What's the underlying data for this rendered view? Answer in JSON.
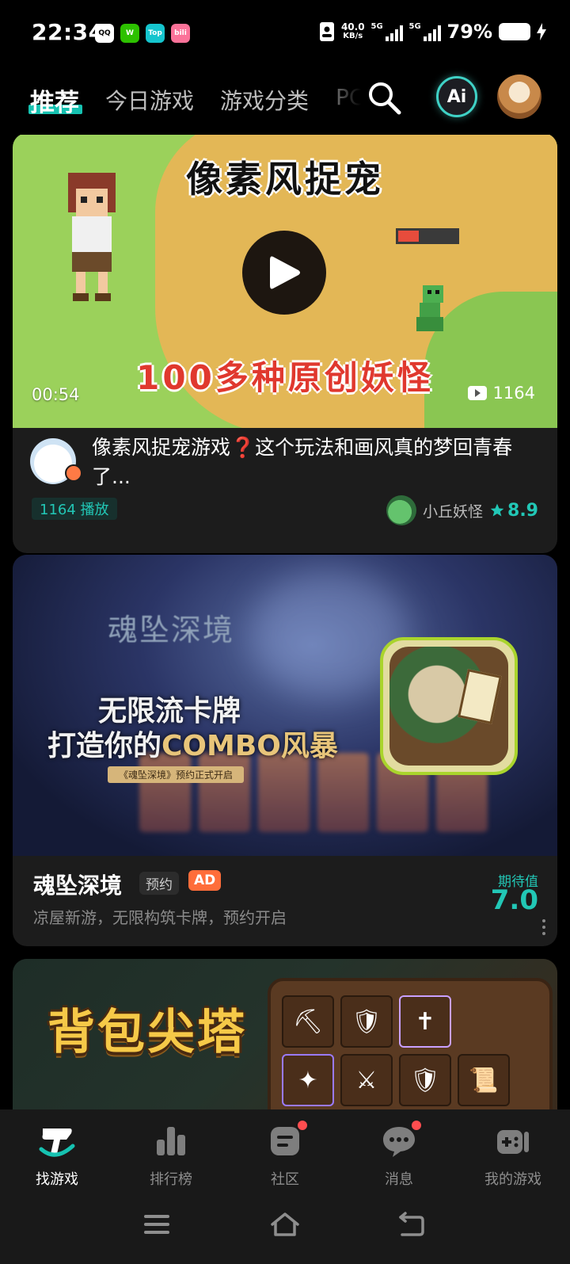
{
  "status_bar": {
    "time": "22:34",
    "notification_apps": [
      {
        "name": "qq-icon",
        "label": "QQ",
        "color": "#ffffff"
      },
      {
        "name": "wechat-icon",
        "label": "W",
        "color": "#2dc100"
      },
      {
        "name": "taptap-icon",
        "label": "Top",
        "color": "#15c5ce"
      },
      {
        "name": "bilibili-icon",
        "label": "bili",
        "color": "#fb7299"
      }
    ],
    "net_speed_value": "40.0",
    "net_speed_unit": "KB/s",
    "signal_1_label": "5G",
    "signal_2_label": "5G",
    "battery_text": "79%"
  },
  "header": {
    "tabs": [
      {
        "label": "推荐",
        "active": true
      },
      {
        "label": "今日游戏",
        "active": false
      },
      {
        "label": "游戏分类",
        "active": false
      },
      {
        "label": "PC",
        "active": false
      }
    ],
    "ai_button_label": "Ai"
  },
  "feed": {
    "video_card": {
      "banner_title": "像素风捉宠",
      "banner_subtitle": "100多种原创妖怪",
      "duration": "00:54",
      "view_count": "1164",
      "description": "像素风捉宠游戏❓这个玩法和画风真的梦回青春了...",
      "play_pill": "1164 播放",
      "game_name": "小丘妖怪",
      "game_score": "8.9"
    },
    "ad_card": {
      "banner_logo": "魂坠深境",
      "banner_line1_prefix": "无限流卡牌",
      "banner_line2_prefix": "打造你的",
      "banner_line2_highlight": "COMBO风暴",
      "banner_tagline": "《魂坠深境》预约正式开启",
      "game_name": "魂坠深境",
      "tag_reserve": "预约",
      "tag_ad": "AD",
      "description": "凉屋新游，无限构筑卡牌，预约开启",
      "expectation_label": "期待值",
      "expectation_value": "7.0"
    },
    "third_card": {
      "banner_title": "背包尖塔"
    }
  },
  "bottom_nav": {
    "items": [
      {
        "label": "找游戏",
        "active": true,
        "badge": false
      },
      {
        "label": "排行榜",
        "active": false,
        "badge": false
      },
      {
        "label": "社区",
        "active": false,
        "badge": true
      },
      {
        "label": "消息",
        "active": false,
        "badge": true
      },
      {
        "label": "我的游戏",
        "active": false,
        "badge": false
      }
    ]
  },
  "colors": {
    "accent": "#16c2b1",
    "badge_red": "#ff4d4f",
    "ad_orange": "#ff6d3a",
    "card_bg": "#1c1c1c"
  }
}
